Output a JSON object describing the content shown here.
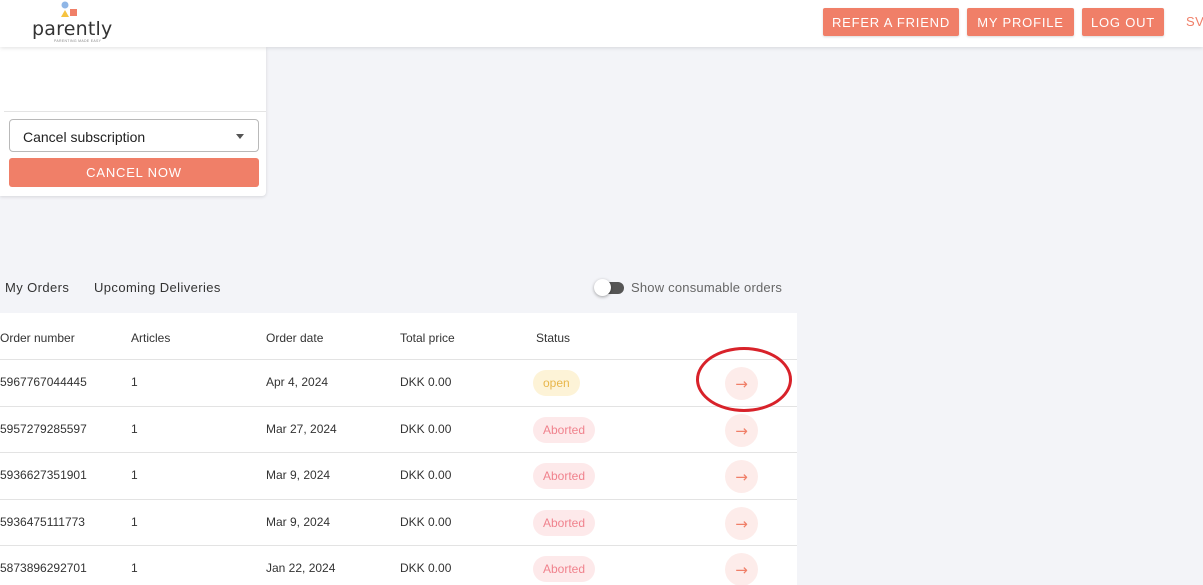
{
  "header": {
    "logo_text": "parently",
    "logo_tagline": "PARENTING MADE EASY",
    "buttons": {
      "refer": "REFER A FRIEND",
      "profile": "MY PROFILE",
      "logout": "LOG OUT"
    },
    "language": "SV",
    "colors": {
      "accent": "#f07f68"
    }
  },
  "subscription_card": {
    "select_value": "Cancel subscription",
    "cancel_button": "CANCEL NOW"
  },
  "tabs": [
    {
      "label": "My Orders",
      "active": true
    },
    {
      "label": "Upcoming Deliveries",
      "active": false
    }
  ],
  "toggle": {
    "label": "Show consumable orders",
    "on": false
  },
  "table": {
    "headers": [
      "Order number",
      "Articles",
      "Order date",
      "Total price",
      "Status"
    ],
    "rows": [
      {
        "order_number": "5967767044445",
        "articles": "1",
        "date": "Apr 4, 2024",
        "price": "DKK 0.00",
        "status": "open"
      },
      {
        "order_number": "5957279285597",
        "articles": "1",
        "date": "Mar 27, 2024",
        "price": "DKK 0.00",
        "status": "Aborted"
      },
      {
        "order_number": "5936627351901",
        "articles": "1",
        "date": "Mar 9, 2024",
        "price": "DKK 0.00",
        "status": "Aborted"
      },
      {
        "order_number": "5936475111773",
        "articles": "1",
        "date": "Mar 9, 2024",
        "price": "DKK 0.00",
        "status": "Aborted"
      },
      {
        "order_number": "5873896292701",
        "articles": "1",
        "date": "Jan 22, 2024",
        "price": "DKK 0.00",
        "status": "Aborted"
      }
    ],
    "row_action_icon": "arrow-right-icon"
  },
  "annotation": {
    "shape": "red-ellipse",
    "target": "first-row-arrow-button",
    "color": "#d8222a"
  }
}
